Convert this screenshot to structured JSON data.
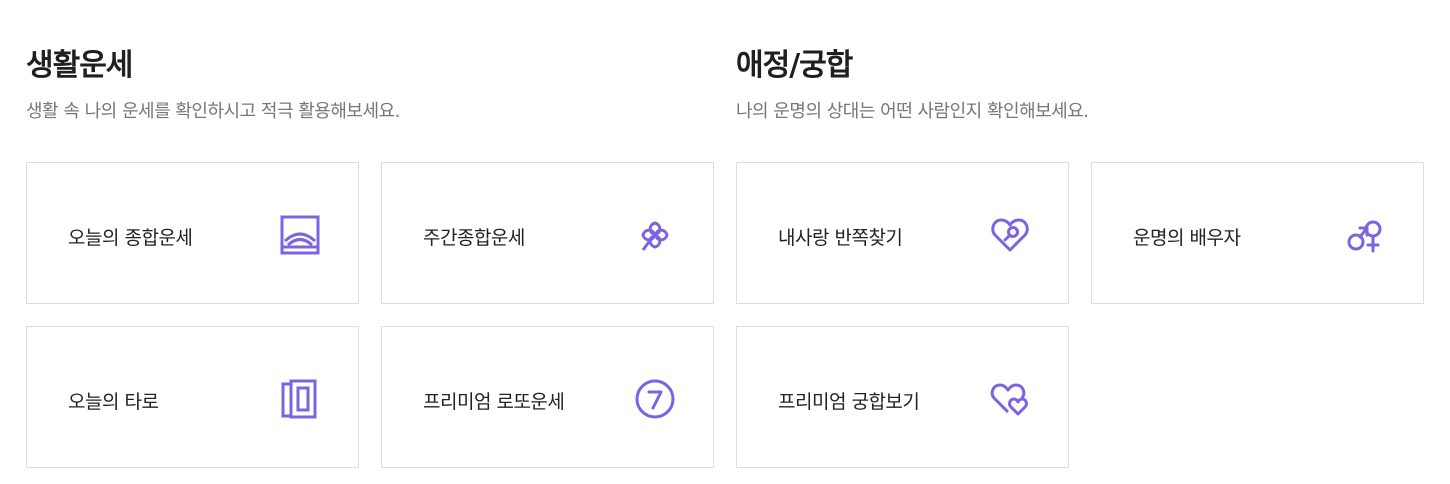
{
  "sections": [
    {
      "title": "생활운세",
      "description": "생활 속 나의 운세를 확인하시고 적극 활용해보세요.",
      "items": [
        {
          "label": "오늘의 종합운세",
          "icon": "sunrise-icon"
        },
        {
          "label": "주간종합운세",
          "icon": "clover-icon"
        },
        {
          "label": "오늘의 타로",
          "icon": "tarot-cards-icon"
        },
        {
          "label": "프리미엄 로또운세",
          "icon": "lucky-seven-icon"
        }
      ]
    },
    {
      "title": "애정/궁합",
      "description": "나의 운명의 상대는 어떤 사람인지 확인해보세요.",
      "items": [
        {
          "label": "내사랑 반쪽찾기",
          "icon": "heart-search-icon"
        },
        {
          "label": "운명의 배우자",
          "icon": "male-female-icon"
        },
        {
          "label": "프리미엄 궁합보기",
          "icon": "double-heart-icon"
        }
      ]
    }
  ],
  "colors": {
    "accent": "#7b64e0",
    "border": "#dddddd",
    "text": "#222222",
    "muted": "#777777"
  }
}
